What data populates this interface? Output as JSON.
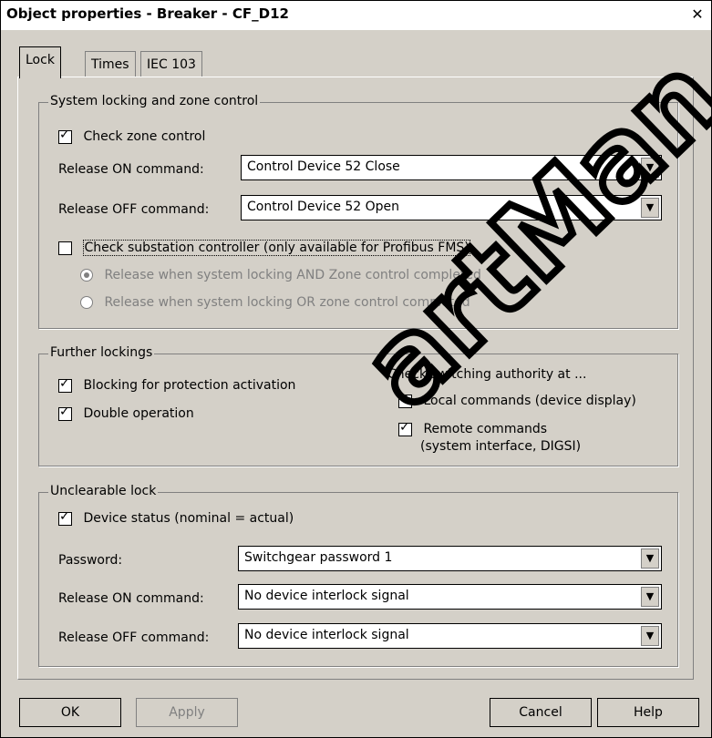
{
  "window": {
    "title": "Object properties - Breaker - CF_D12",
    "close_glyph": "✕"
  },
  "tabs": [
    {
      "label": "Lock"
    },
    {
      "label": "Times"
    },
    {
      "label": "IEC 103"
    }
  ],
  "system_group": {
    "title": "System locking and zone control",
    "check_zone_control": {
      "label": "Check zone control",
      "checked": true
    },
    "release_on": {
      "label": "Release ON command:",
      "value": "Control Device    52 Close"
    },
    "release_off": {
      "label": "Release OFF command:",
      "value": "Control Device    52 Open"
    },
    "check_substation": {
      "label": "Check substation controller (only available for Profibus FMS)",
      "checked": false
    },
    "radio_and": {
      "label": "Release when system locking AND Zone control completed",
      "selected": true
    },
    "radio_or": {
      "label": "Release when system locking OR zone control completed",
      "selected": false
    }
  },
  "further_group": {
    "title": "Further lockings",
    "blocking_protection": {
      "label": "Blocking for protection activation",
      "checked": true
    },
    "double_operation": {
      "label": "Double operation",
      "checked": true
    },
    "authority_label": "Check switching authority at ...",
    "local_commands": {
      "label": "Local commands (device display)",
      "checked": true
    },
    "remote_commands": {
      "label": "Remote commands",
      "sublabel": "(system interface, DIGSI)",
      "checked": true
    }
  },
  "unclearable_group": {
    "title": "Unclearable lock",
    "device_status": {
      "label": "Device status (nominal = actual)",
      "checked": true
    },
    "password": {
      "label": "Password:",
      "value": "Switchgear password  1"
    },
    "release_on": {
      "label": "Release ON command:",
      "value": "No device interlock signal"
    },
    "release_off": {
      "label": "Release OFF command:",
      "value": "No device interlock signal"
    }
  },
  "buttons": {
    "ok": "OK",
    "apply": "Apply",
    "cancel": "Cancel",
    "help": "Help"
  },
  "watermark": "artMan"
}
